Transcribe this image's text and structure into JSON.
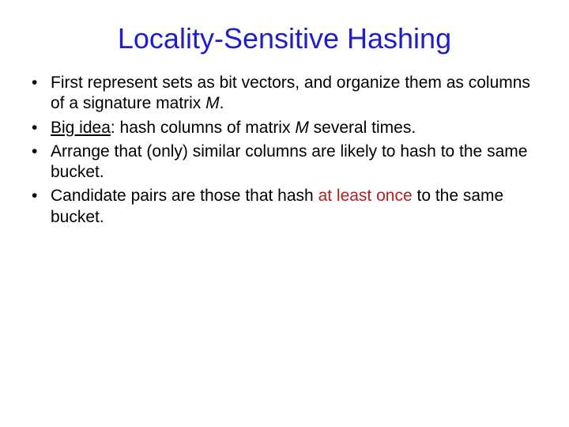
{
  "title": "Locality-Sensitive Hashing",
  "bullets": {
    "b1": {
      "t1": "First represent sets as bit vectors, and organize them as columns of a signature matrix ",
      "m": "M",
      "t2": "."
    },
    "b2": {
      "lead": "Big idea",
      "t1": ": hash columns of matrix ",
      "m": "M",
      "t2": "  several times."
    },
    "b3": {
      "t1": "Arrange that (only) similar columns are likely to hash to the same bucket."
    },
    "b4": {
      "t1": "Candidate pairs are those that hash ",
      "em": "at least once",
      "t2": " to the same bucket."
    }
  }
}
